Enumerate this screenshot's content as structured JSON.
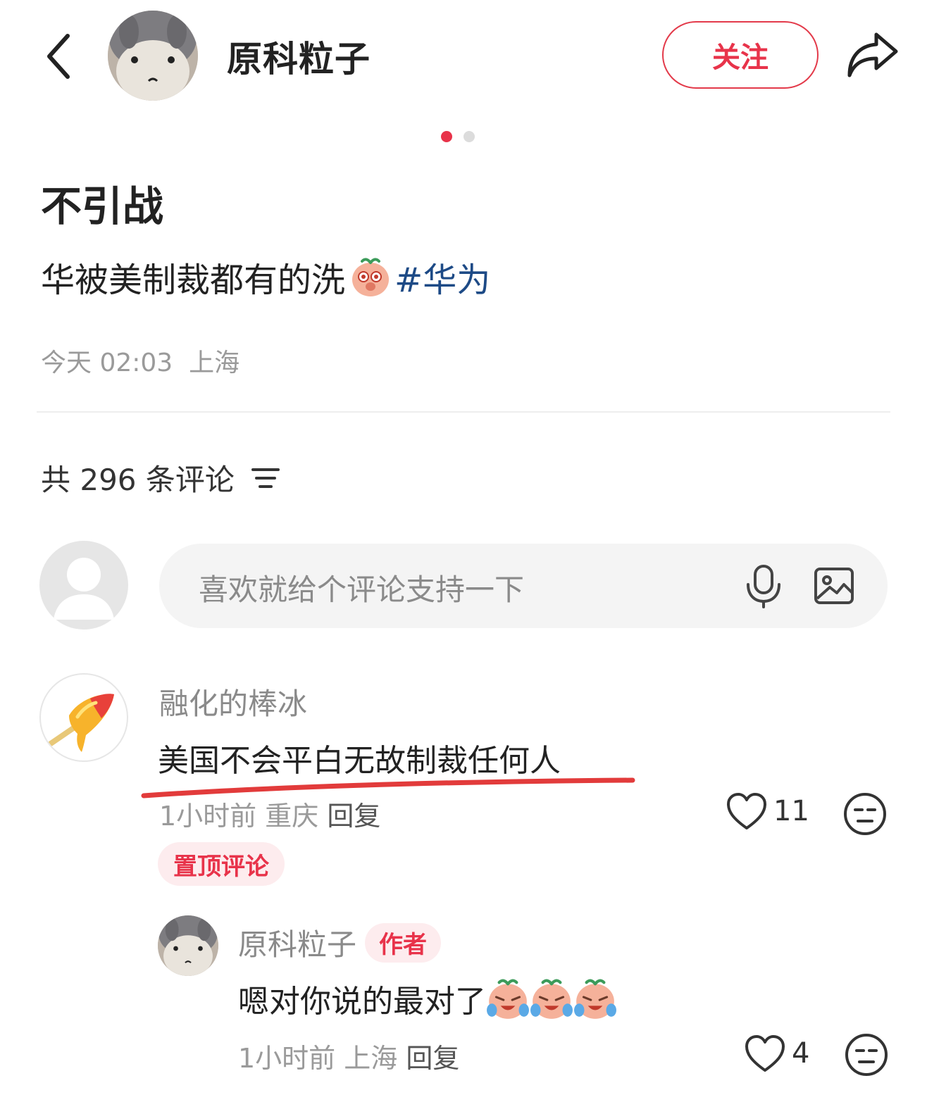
{
  "header": {
    "author_name": "原科粒子",
    "follow_label": "关注"
  },
  "carousel": {
    "total": 2,
    "active": 1
  },
  "post": {
    "title": "不引战",
    "body_text": "华被美制裁都有的洗",
    "hashtag": "#华为",
    "time": "今天 02:03",
    "location": "上海"
  },
  "comments_section": {
    "count_label": "共 296 条评论",
    "input_placeholder": "喜欢就给个评论支持一下"
  },
  "comments": [
    {
      "user": "融化的棒冰",
      "text": "美国不会平白无故制裁任何人",
      "time": "1小时前",
      "location": "重庆",
      "reply_label": "回复",
      "likes": "11",
      "badge": "置顶评论",
      "replies": [
        {
          "user": "原科粒子",
          "author_badge": "作者",
          "text": "嗯对你说的最对了",
          "time": "1小时前",
          "location": "上海",
          "reply_label": "回复",
          "likes": "4"
        }
      ]
    }
  ],
  "colors": {
    "accent": "#e8334a",
    "hashtag": "#1d4a86",
    "muted": "#9a9a9a"
  }
}
